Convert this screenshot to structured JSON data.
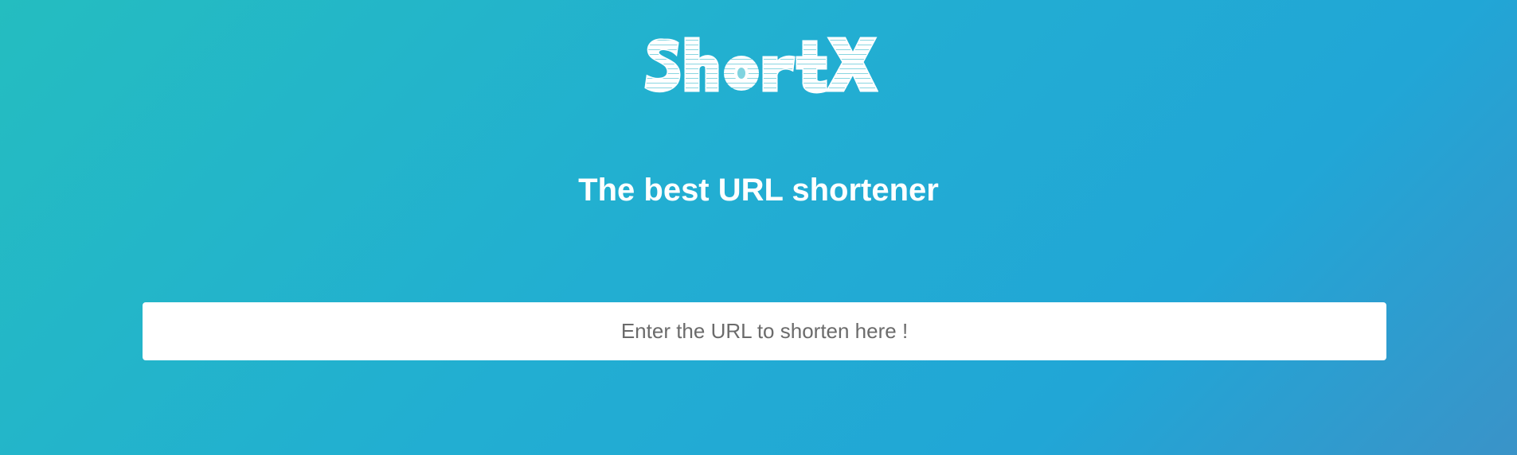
{
  "logo": {
    "text": "ShortX",
    "icon": "shortx-logo"
  },
  "hero": {
    "tagline": "The best URL shortener"
  },
  "shorten_form": {
    "url_input_placeholder": "Enter the URL to shorten here !",
    "url_input_value": ""
  },
  "colors": {
    "background_start": "#24bdc0",
    "background_end": "#3a93c8",
    "text": "#ffffff",
    "input_background": "#ffffff",
    "placeholder": "#6b6b6b"
  }
}
